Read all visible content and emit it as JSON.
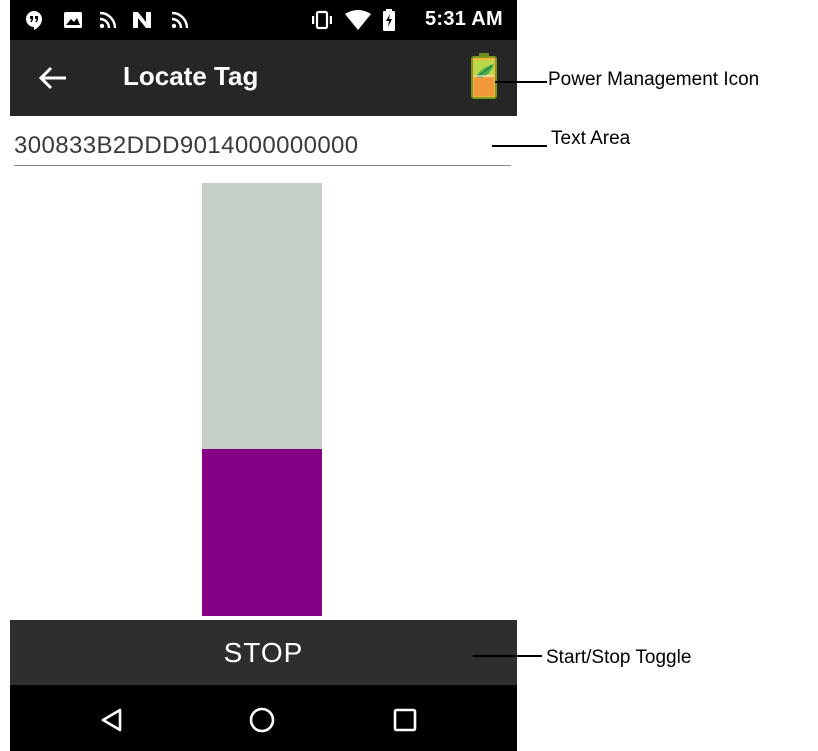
{
  "status_bar": {
    "time": "5:31 AM",
    "icons": [
      "hangouts-icon",
      "image-icon",
      "nfc-icon",
      "n-icon",
      "nfc-icon",
      "vibrate-icon",
      "wifi-icon",
      "battery-charging-icon"
    ]
  },
  "app_bar": {
    "title": "Locate Tag",
    "back_icon": "arrow-left-icon",
    "power_icon": "battery-leaf-icon"
  },
  "tag_field": {
    "value": "300833B2DDD9014000000000"
  },
  "proximity_meter": {
    "level": 0.385,
    "fill_color": "#850085",
    "track_color": "#c6d0c8"
  },
  "toggle_button": {
    "label": "STOP"
  },
  "nav_bar": {
    "icons": [
      "back-triangle-icon",
      "home-circle-icon",
      "recents-square-icon"
    ]
  },
  "callouts": {
    "power": "Power Management Icon",
    "text_area": "Text Area",
    "toggle": "Start/Stop Toggle"
  }
}
